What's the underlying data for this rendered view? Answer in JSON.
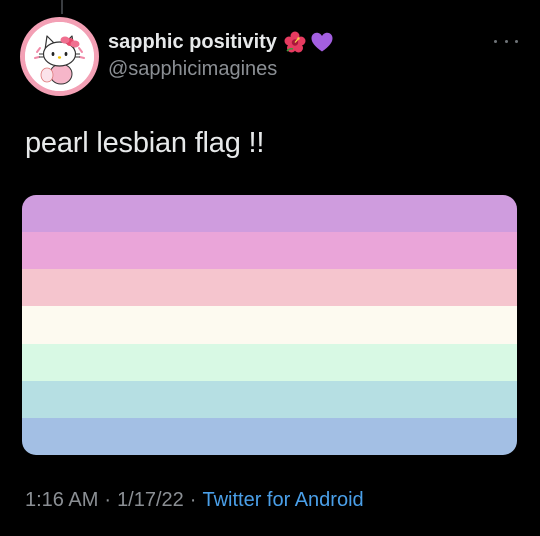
{
  "tweet": {
    "display_name": "sapphic positivity",
    "name_emojis": [
      "hibiscus-icon",
      "purple-heart-icon"
    ],
    "handle": "@sapphicimagines",
    "text": "pearl lesbian flag !!",
    "flag_stripes": [
      "#cf9cde",
      "#eaa5d9",
      "#f5c5ce",
      "#fdfaf0",
      "#d8f9e4",
      "#b6dfe3",
      "#a3bfe4"
    ],
    "time": "1:16 AM",
    "separator": "·",
    "date": "1/17/22",
    "client": "Twitter for Android"
  },
  "colors": {
    "background": "#000000",
    "text": "#e7e9ea",
    "muted": "#8b8f94",
    "link": "#4a9fe8",
    "avatar_ring": "#f3a0b5"
  }
}
